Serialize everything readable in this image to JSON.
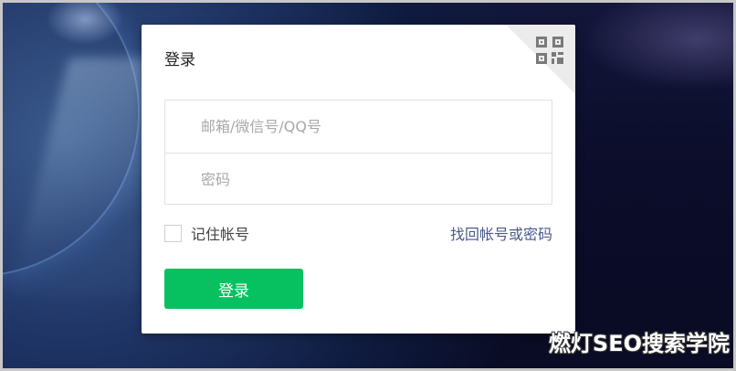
{
  "dialog": {
    "title": "登录",
    "account_placeholder": "邮箱/微信号/QQ号",
    "password_placeholder": "密码",
    "remember_label": "记住帐号",
    "forgot_link": "找回帐号或密码",
    "login_button": "登录",
    "corner_icon": "qr-code-icon"
  },
  "watermark": "燃灯SEO搜索学院",
  "colors": {
    "accent": "#07c160",
    "link": "#4a5a8a",
    "background": "#0b0d2a"
  }
}
